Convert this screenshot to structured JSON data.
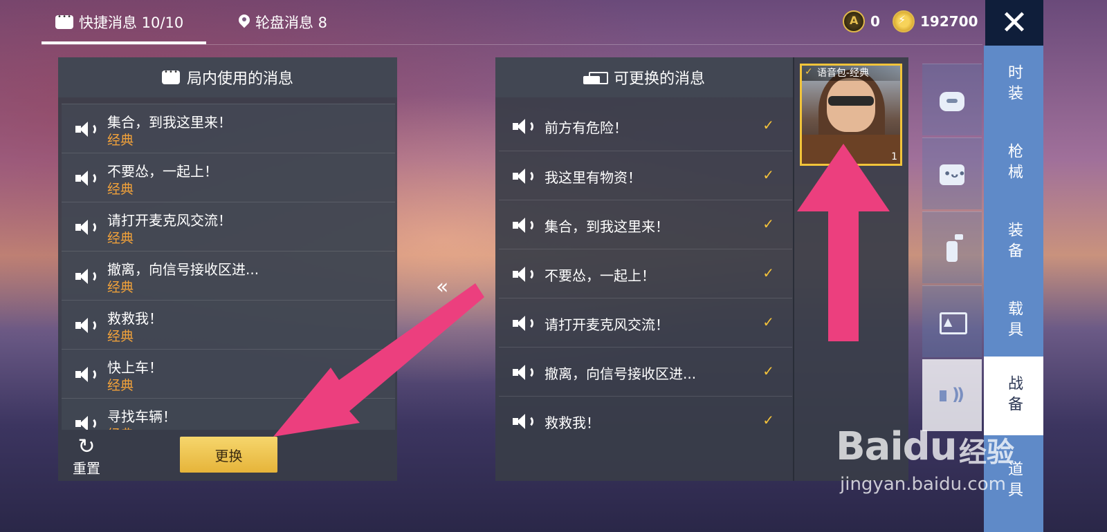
{
  "top_tabs": {
    "quick_messages": "快捷消息 10/10",
    "wheel_messages": "轮盘消息 8"
  },
  "currency": {
    "coin_a": "0",
    "coin_b": "192700"
  },
  "close_label": "✕",
  "left_panel": {
    "title": "局内使用的消息",
    "items": [
      {
        "text": "集合，到我这里来！",
        "tag": "经典"
      },
      {
        "text": "不要怂，一起上！",
        "tag": "经典"
      },
      {
        "text": "请打开麦克风交流！",
        "tag": "经典"
      },
      {
        "text": "撤离，向信号接收区进...",
        "tag": "经典"
      },
      {
        "text": "救救我！",
        "tag": "经典"
      },
      {
        "text": "快上车！",
        "tag": "经典"
      },
      {
        "text": "寻找车辆！",
        "tag": "经典"
      }
    ],
    "reset_label": "重置",
    "replace_label": "更换"
  },
  "collapse_label": "«",
  "right_panel": {
    "title": "可更换的消息",
    "items": [
      {
        "text": "前方有危险！",
        "checked": true
      },
      {
        "text": "我这里有物资！",
        "checked": true
      },
      {
        "text": "集合，到我这里来！",
        "checked": true
      },
      {
        "text": "不要怂，一起上！",
        "checked": true
      },
      {
        "text": "请打开麦克风交流！",
        "checked": true
      },
      {
        "text": "撤离，向信号接收区进...",
        "checked": true
      },
      {
        "text": "救救我！",
        "checked": true
      }
    ],
    "check_mark": "✓"
  },
  "voice_pack": {
    "label": "语音包-经典",
    "count": "1"
  },
  "category_icons": [
    "robot-icon",
    "emote-icon",
    "spray-icon",
    "pics-icon",
    "voice-icon"
  ],
  "main_tabs": [
    "时装",
    "枪械",
    "装备",
    "载具",
    "战备",
    "道具"
  ],
  "active_main_tab": "战备",
  "watermark": {
    "logo": "Baidu",
    "sub": "经验",
    "url": "jingyan.baidu.com"
  },
  "colors": {
    "tag_orange": "#f2a23a",
    "check_yellow": "#f5c33a",
    "button_gold": "#e6b43a",
    "arrow_pink": "#ec3f7e",
    "sidebar_blue": "#5f8ac8"
  }
}
